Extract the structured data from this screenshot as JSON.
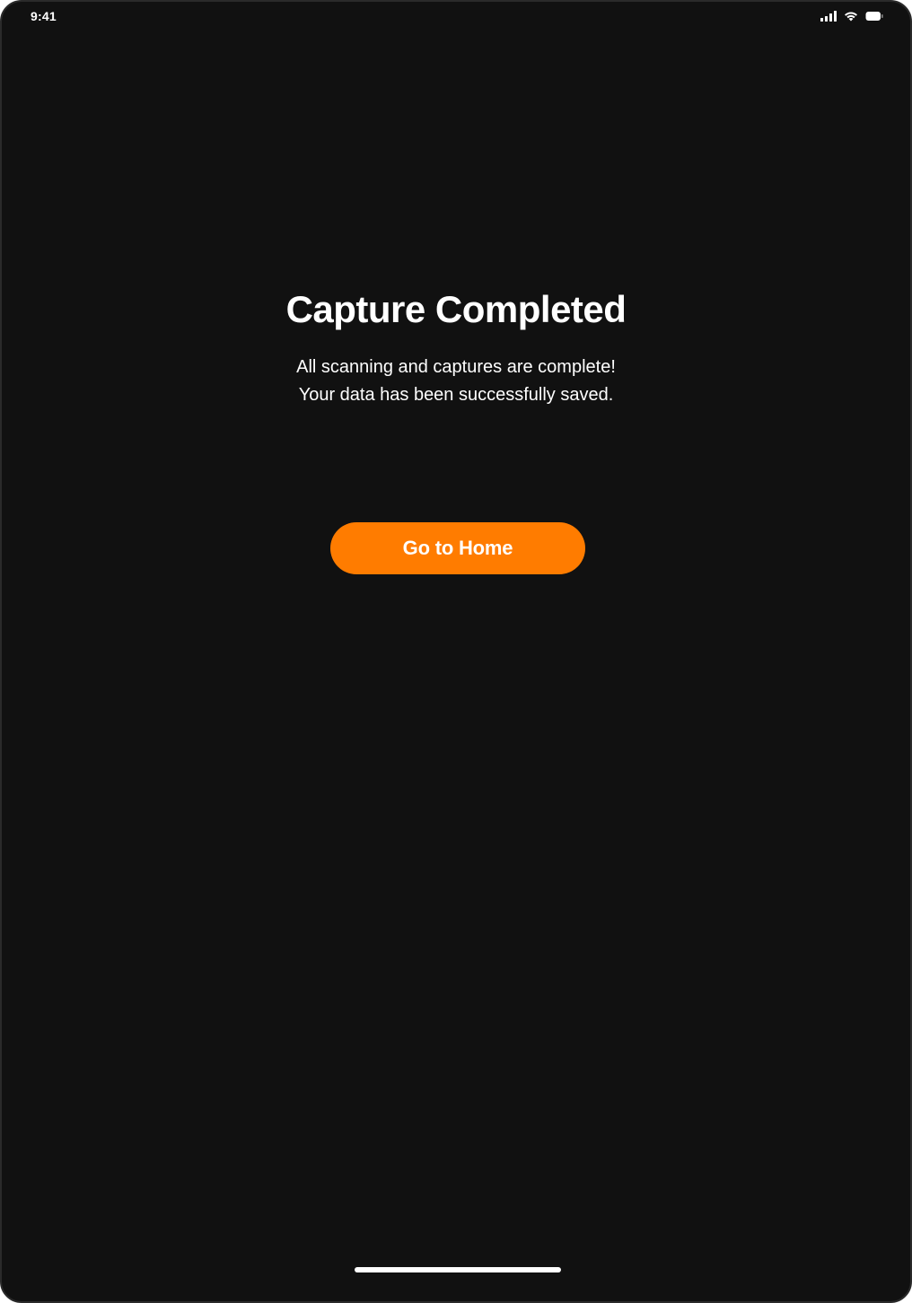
{
  "status_bar": {
    "time": "9:41",
    "icons": [
      "cellular-signal-icon",
      "wifi-icon",
      "battery-icon"
    ]
  },
  "screen": {
    "title": "Capture Completed",
    "message_lines": [
      "All scanning and captures are complete!",
      "Your data has been successfully saved."
    ]
  },
  "actions": {
    "home_button_label": "Go to Home"
  },
  "colors": {
    "background": "#111111",
    "accent": "#ff7c00",
    "text": "#ffffff"
  }
}
